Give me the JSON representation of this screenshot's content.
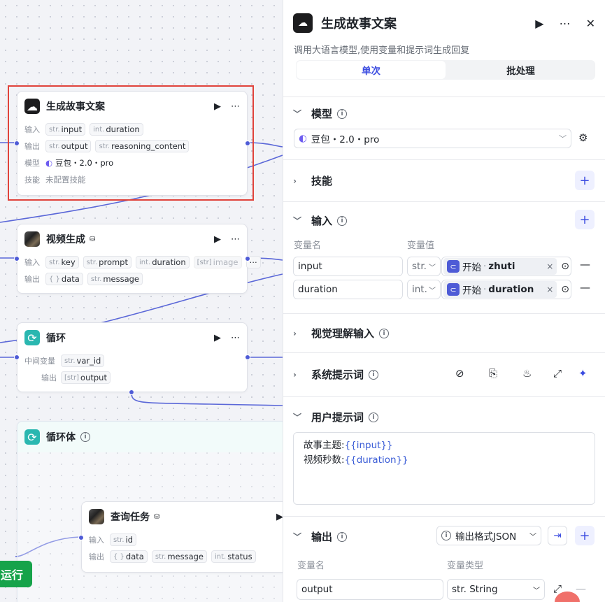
{
  "canvas": {
    "node1": {
      "title": "生成故事文案",
      "in_label": "输入",
      "in": [
        {
          "t": "str.",
          "n": "input"
        },
        {
          "t": "int.",
          "n": "duration"
        }
      ],
      "out_label": "输出",
      "out": [
        {
          "t": "str.",
          "n": "output"
        },
        {
          "t": "str.",
          "n": "reasoning_content"
        }
      ],
      "model_label": "模型",
      "model": "豆包・2.0・pro",
      "skill_label": "技能",
      "skill": "未配置技能"
    },
    "node2": {
      "title": "视频生成",
      "in_label": "输入",
      "in": [
        {
          "t": "str.",
          "n": "key"
        },
        {
          "t": "str.",
          "n": "prompt"
        },
        {
          "t": "int.",
          "n": "duration"
        },
        {
          "t": "[str]",
          "n": "image"
        }
      ],
      "out_label": "输出",
      "out": [
        {
          "t": "{ }",
          "n": "data"
        },
        {
          "t": "str.",
          "n": "message"
        }
      ]
    },
    "node3": {
      "title": "循环",
      "mid_label": "中间变量",
      "mid": {
        "t": "str.",
        "n": "var_id"
      },
      "out_label": "输出",
      "out": {
        "t": "[str]",
        "n": "output"
      }
    },
    "node4": {
      "title": "循环体"
    },
    "node5": {
      "title": "查询任务",
      "in_label": "输入",
      "in": {
        "t": "str.",
        "n": "id"
      },
      "out_label": "输出",
      "out": [
        {
          "t": "{ }",
          "n": "data"
        },
        {
          "t": "str.",
          "n": "message"
        },
        {
          "t": "int.",
          "n": "status"
        }
      ]
    },
    "run_label": "运行"
  },
  "panel": {
    "title": "生成故事文案",
    "desc": "调用大语言模型,使用变量和提示词生成回复",
    "tabs": [
      "单次",
      "批处理"
    ],
    "model_section": "模型",
    "model_value": "豆包・2.0・pro",
    "skill_section": "技能",
    "input_section": "输入",
    "col_name": "变量名",
    "col_value": "变量值",
    "inputs": [
      {
        "name": "input",
        "type": "str.",
        "src": "开始",
        "var": "zhuti"
      },
      {
        "name": "duration",
        "type": "int.",
        "src": "开始",
        "var": "duration"
      }
    ],
    "visual_section": "视觉理解输入",
    "sys_section": "系统提示词",
    "user_section": "用户提示词",
    "prompt": [
      {
        "k": "故事主题:",
        "v": "{{input}}"
      },
      {
        "k": "视频秒数:",
        "v": "{{duration}}"
      }
    ],
    "output_section": "输出",
    "output_format": "输出格式JSON",
    "out_col_name": "变量名",
    "out_col_type": "变量类型",
    "out_name": "output",
    "out_type": "str. String"
  },
  "colors": {
    "accent": "#3a4be0",
    "wire": "#5a67d8",
    "selection": "#e0433b",
    "run": "#16a34a"
  }
}
